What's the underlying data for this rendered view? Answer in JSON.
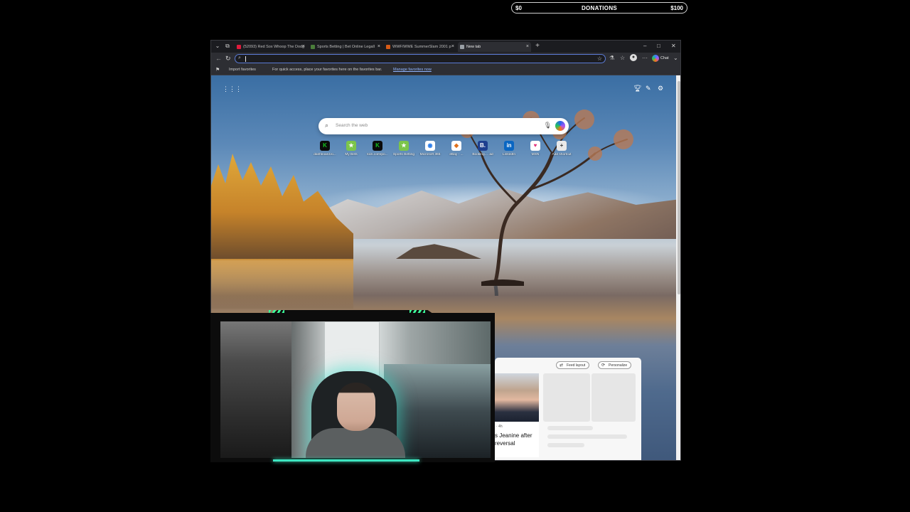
{
  "donations": {
    "min": "$0",
    "label": "DONATIONS",
    "max": "$100",
    "progress": 0
  },
  "browser": {
    "tabs": [
      {
        "title": "(52093) Red Sox Whoop The Dodg",
        "fav_color": "#e01b3c",
        "active": false
      },
      {
        "title": "Sports Betting | Bet Online Legall",
        "fav_color": "#4a7d3a",
        "active": false
      },
      {
        "title": "WWF/WWE SummerSlam 2001 p",
        "fav_color": "#d65a16",
        "active": false
      },
      {
        "title": "New tab",
        "fav_color": "#9aa0a6",
        "active": true
      }
    ],
    "new_tab": "+",
    "address": {
      "value": ""
    },
    "chat_label": "Chat",
    "favorites": {
      "import_label": "Import favorites",
      "message": "For quick access, place your favorites here on the favorites bar.",
      "manage_link": "Manage favorites now"
    }
  },
  "newtab": {
    "search_placeholder": "Search the web",
    "shortcuts": [
      {
        "label": "dashboard.ki...",
        "glyph": "K",
        "color": "#15c21f",
        "bg": "#0b0b0b"
      },
      {
        "label": "My Bets",
        "glyph": "★",
        "color": "#ffffff",
        "bg": "#7cc54a"
      },
      {
        "label": "kick.com/po...",
        "glyph": "K",
        "color": "#15c21f",
        "bg": "#0b0b0b"
      },
      {
        "label": "Sports Betting",
        "glyph": "★",
        "color": "#ffffff",
        "bg": "#7cc54a"
      },
      {
        "label": "Microsoft 365",
        "glyph": "◉",
        "color": "#2b7de9",
        "bg": "#ffffff"
      },
      {
        "label": "eBay - ...",
        "glyph": "◆",
        "color": "#e0701b",
        "bg": "#ffffff"
      },
      {
        "label": "Booking.... ad",
        "glyph": "B.",
        "color": "#ffffff",
        "bg": "#1e3f8f"
      },
      {
        "label": "LinkedIn",
        "glyph": "in",
        "color": "#ffffff",
        "bg": "#0a66c2"
      },
      {
        "label": "MSN",
        "glyph": "♥",
        "color": "#e2317a",
        "bg": "#ffffff"
      },
      {
        "label": "Add shortcut",
        "glyph": "+",
        "color": "#333333",
        "bg": "#e9e9e9"
      }
    ]
  },
  "feed": {
    "layout_label": "Feed layout",
    "personalize_label": "Personalize",
    "story": {
      "source": "· 4h",
      "headline": "s Jeanine after reversal"
    }
  }
}
